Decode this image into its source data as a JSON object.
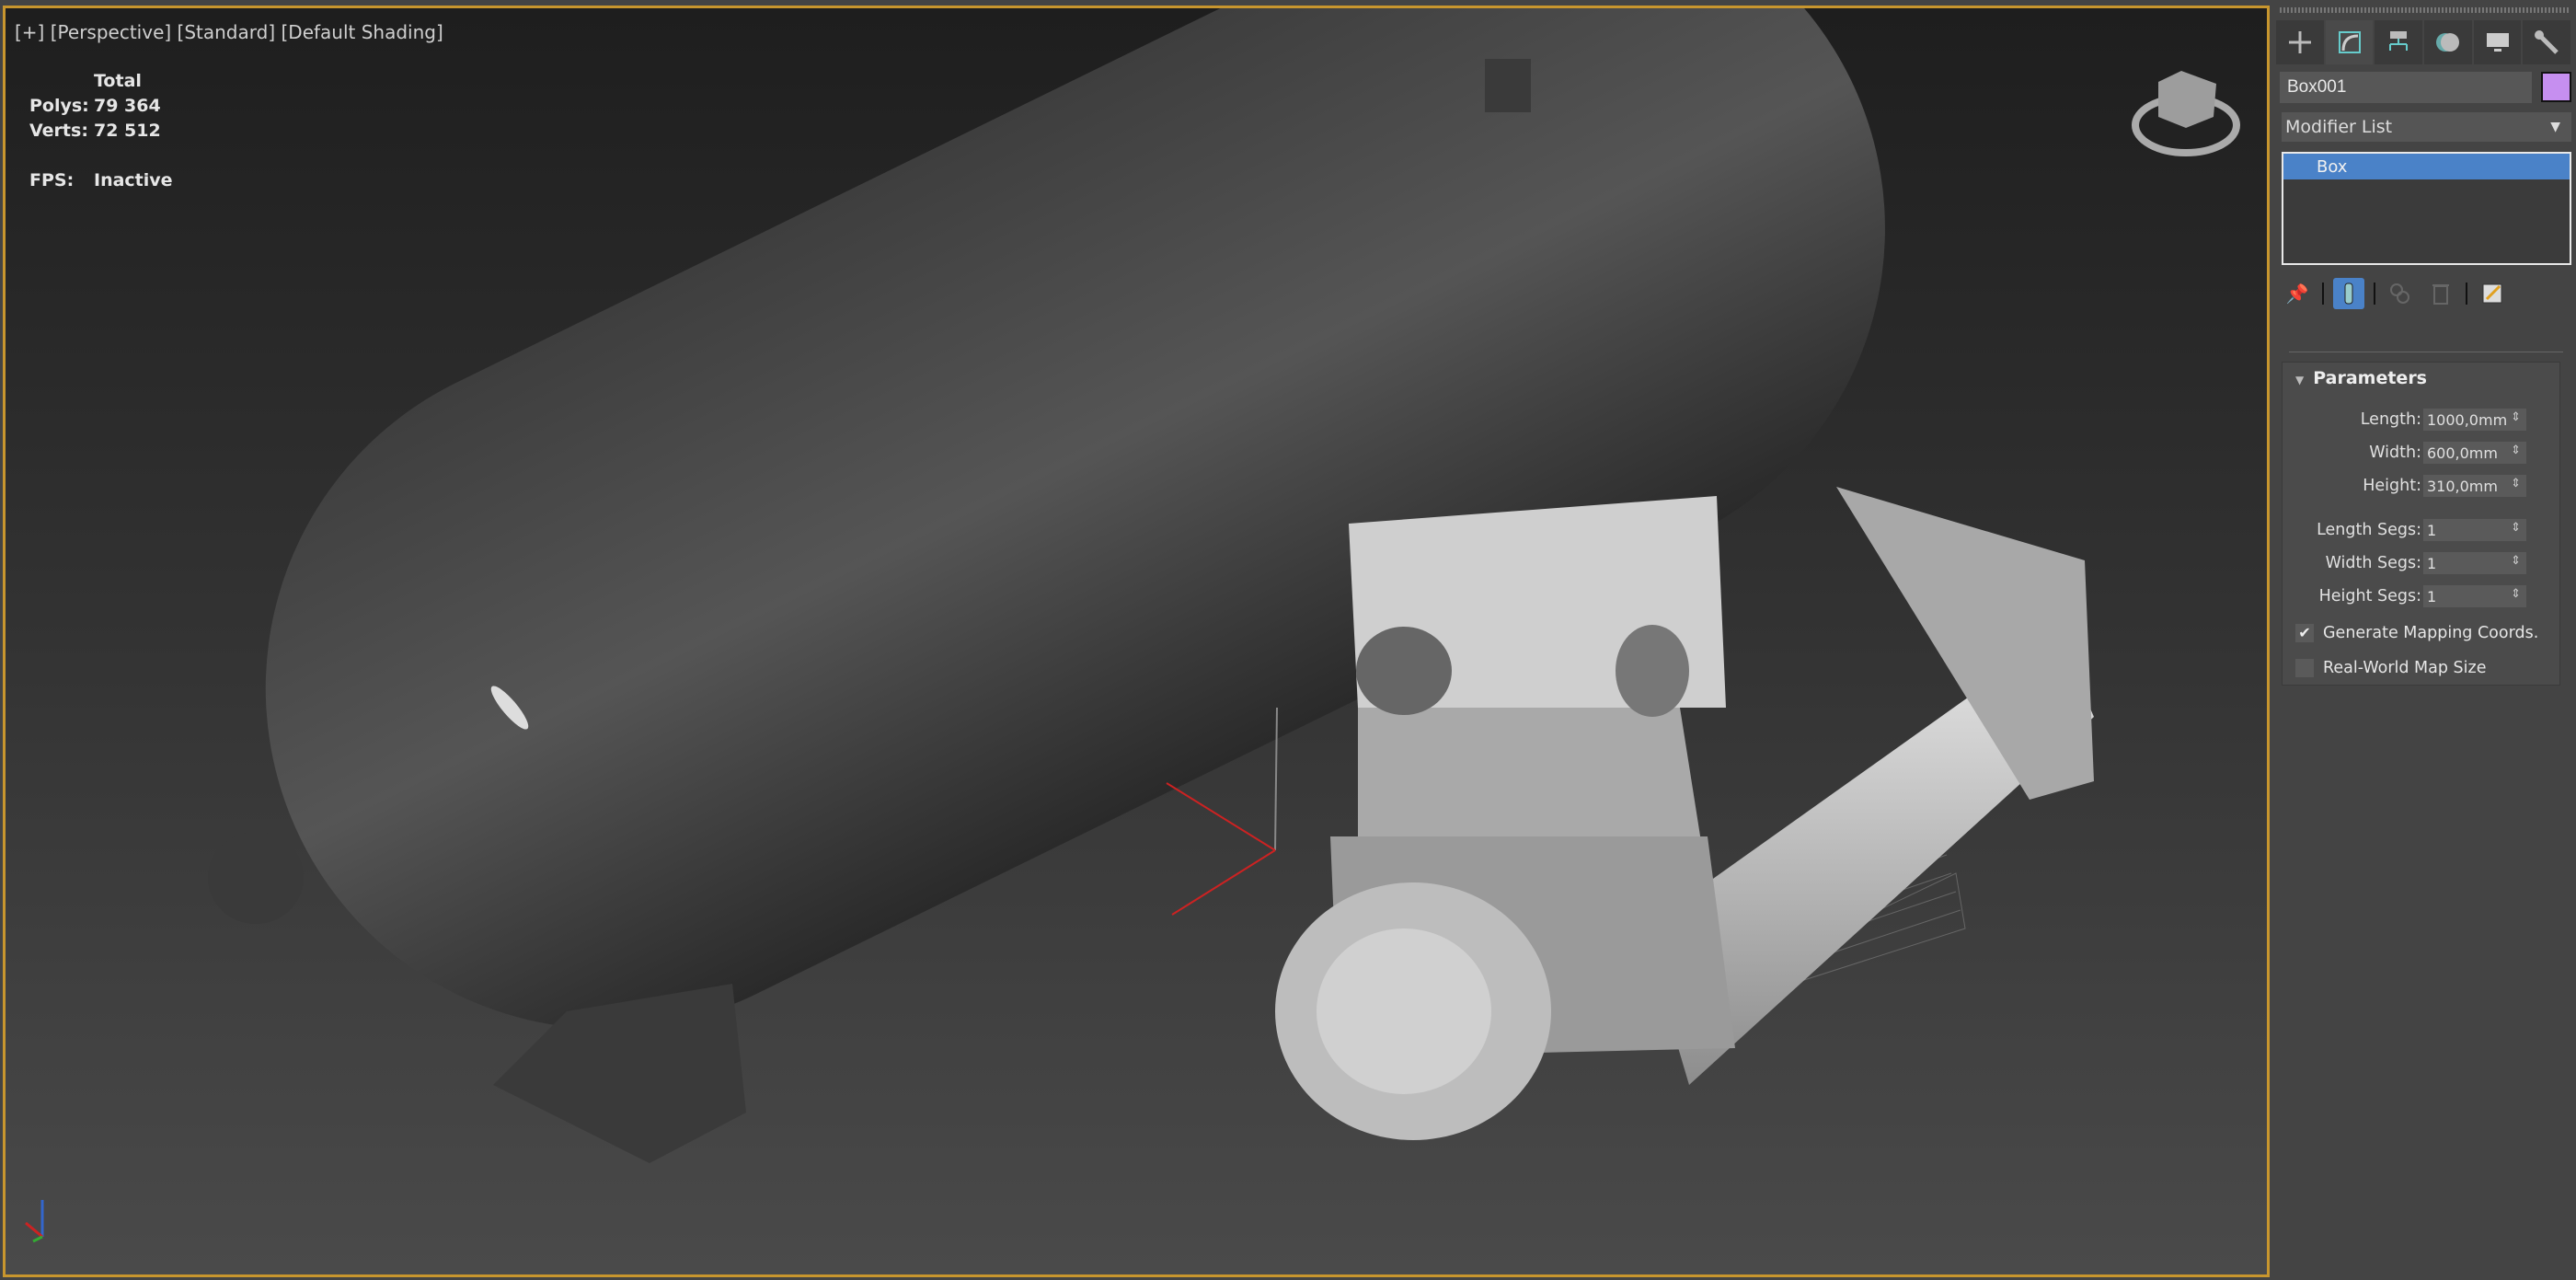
{
  "viewport": {
    "label_plus": "[+]",
    "label_view": "[Perspective]",
    "label_render": "[Standard]",
    "label_shading": "[Default Shading]",
    "stats": {
      "header": "Total",
      "polys_label": "Polys:",
      "polys_value": "79 364",
      "verts_label": "Verts:",
      "verts_value": "72 512",
      "fps_label": "FPS:",
      "fps_value": "Inactive"
    },
    "accent_border": "#c8962e"
  },
  "panel": {
    "tabs": [
      "create-icon",
      "modify-icon",
      "hierarchy-icon",
      "motion-icon",
      "display-icon",
      "utilities-icon"
    ],
    "active_tab": 1,
    "object_name": "Box001",
    "object_color": "#c68ff0",
    "modifier_list": "Modifier List",
    "stack": [
      "Box"
    ],
    "parameters": {
      "title": "Parameters",
      "length_label": "Length:",
      "length": "1000,0mm",
      "width_label": "Width:",
      "width": "600,0mm",
      "height_label": "Height:",
      "height": "310,0mm",
      "length_segs_label": "Length Segs:",
      "length_segs": "1",
      "width_segs_label": "Width Segs:",
      "width_segs": "1",
      "height_segs_label": "Height Segs:",
      "height_segs": "1",
      "gen_mapping_label": "Generate Mapping Coords.",
      "gen_mapping": true,
      "real_world_label": "Real-World Map Size",
      "real_world": false
    }
  }
}
